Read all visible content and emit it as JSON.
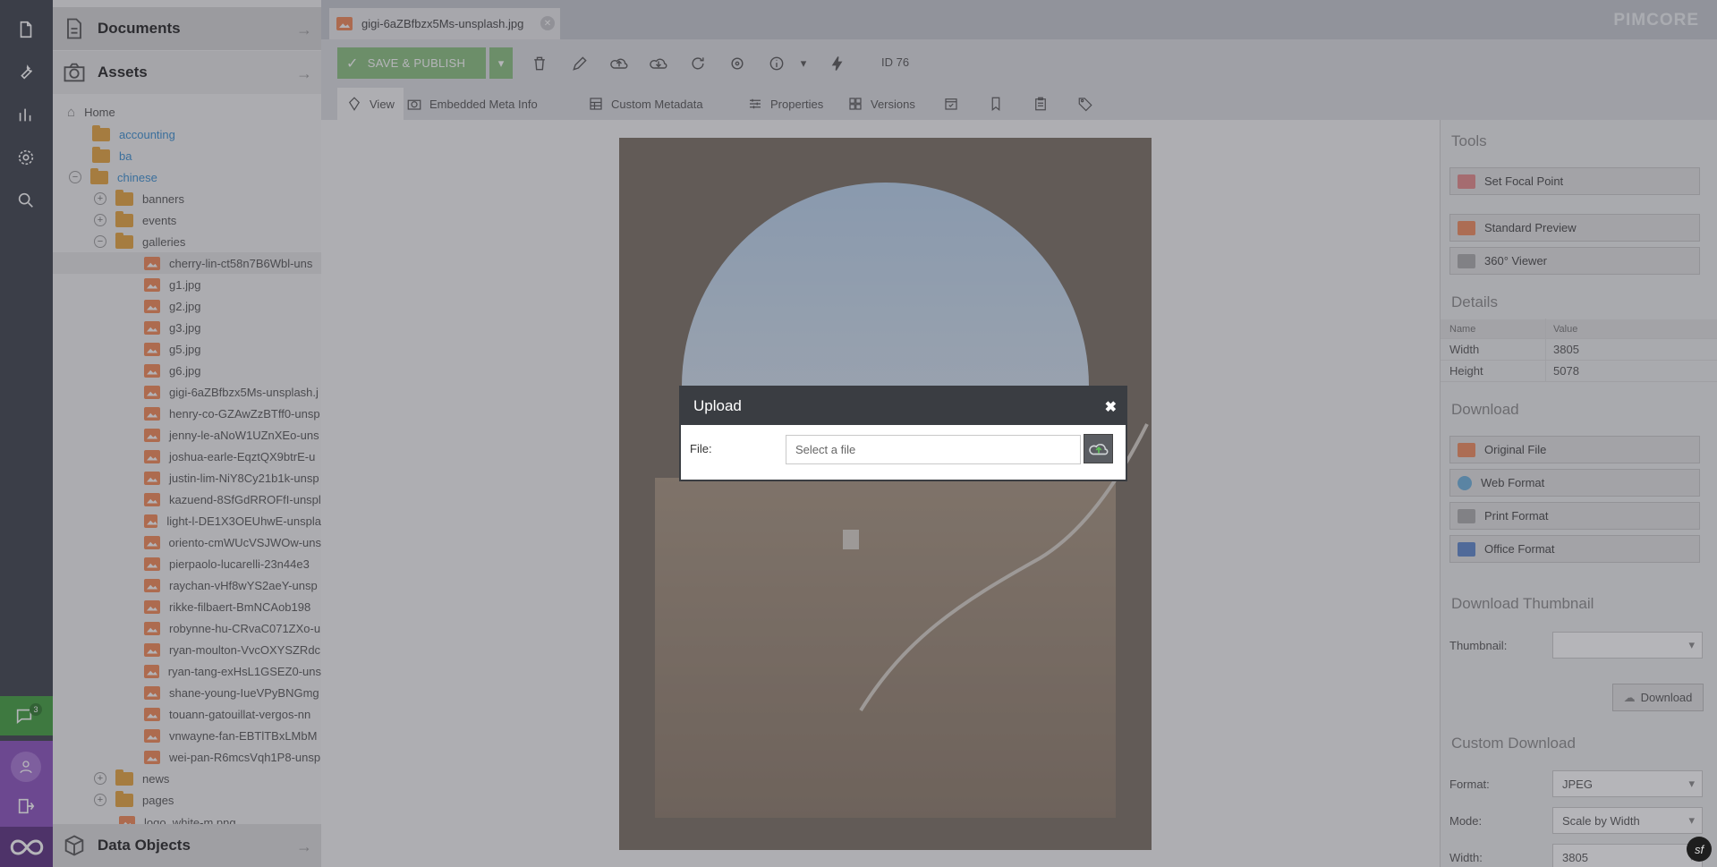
{
  "rail": {
    "icons": [
      "file-icon",
      "wrench-icon",
      "bar-chart-icon",
      "gear-icon",
      "search-icon"
    ],
    "chat_count": "3"
  },
  "tree": {
    "documents_label": "Documents",
    "assets_label": "Assets",
    "data_objects_label": "Data Objects",
    "home_label": "Home",
    "folders_top": [
      "accounting",
      "ba",
      "chinese"
    ],
    "subfolders": [
      "banners",
      "events",
      "galleries"
    ],
    "files": [
      "cherry-lin-ct58n7B6Wbl-uns",
      "g1.jpg",
      "g2.jpg",
      "g3.jpg",
      "g5.jpg",
      "g6.jpg",
      "gigi-6aZBfbzx5Ms-unsplash.j",
      "henry-co-GZAwZzBTff0-unsp",
      "jenny-le-aNoW1UZnXEo-uns",
      "joshua-earle-EqztQX9btrE-u",
      "justin-lim-NiY8Cy21b1k-unsp",
      "kazuend-8SfGdRROFfI-unspl",
      "light-l-DE1X3OEUhwE-unspla",
      "oriento-cmWUcVSJWOw-uns",
      "pierpaolo-lucarelli-23n44e3",
      "raychan-vHf8wYS2aeY-unsp",
      "rikke-filbaert-BmNCAob198",
      "robynne-hu-CRvaC071ZXo-u",
      "ryan-moulton-VvcOXYSZRdc",
      "ryan-tang-exHsL1GSEZ0-uns",
      "shane-young-IueVPyBNGmg",
      "touann-gatouillat-vergos-nn",
      "vnwayne-fan-EBTlTBxLMbM",
      "wei-pan-R6mcsVqh1P8-unsp"
    ],
    "bottom_folders": [
      "news",
      "pages"
    ],
    "partial_file": "logo_white-m.png"
  },
  "tab": {
    "title": "gigi-6aZBfbzx5Ms-unsplash.jpg"
  },
  "brand": "PIMCORE",
  "toolbar": {
    "save_label": "SAVE & PUBLISH",
    "id_label": "ID 76"
  },
  "subtabs": [
    "View",
    "Embedded Meta Info",
    "Custom Metadata",
    "Properties",
    "Versions"
  ],
  "tools": {
    "tools_head": "Tools",
    "set_focal": "Set Focal Point",
    "standard_preview": "Standard Preview",
    "viewer_360": "360° Viewer",
    "details_head": "Details",
    "details_cols": [
      "Name",
      "Value"
    ],
    "details_rows": [
      [
        "Width",
        "3805"
      ],
      [
        "Height",
        "5078"
      ]
    ],
    "download_head": "Download",
    "original_file": "Original File",
    "web_format": "Web Format",
    "print_format": "Print Format",
    "office_format": "Office Format",
    "dl_thumb_head": "Download Thumbnail",
    "thumbnail_label": "Thumbnail:",
    "download_btn": "Download",
    "custom_dl_head": "Custom Download",
    "format_label": "Format:",
    "format_value": "JPEG",
    "mode_label": "Mode:",
    "mode_value": "Scale by Width",
    "width_label": "Width:",
    "width_value": "3805"
  },
  "modal": {
    "title": "Upload",
    "file_label": "File:",
    "file_placeholder": "Select a file"
  },
  "colors": {
    "accent_green": "#3f9e3c",
    "purple": "#8a4fbd",
    "orange": "#f3763b"
  }
}
